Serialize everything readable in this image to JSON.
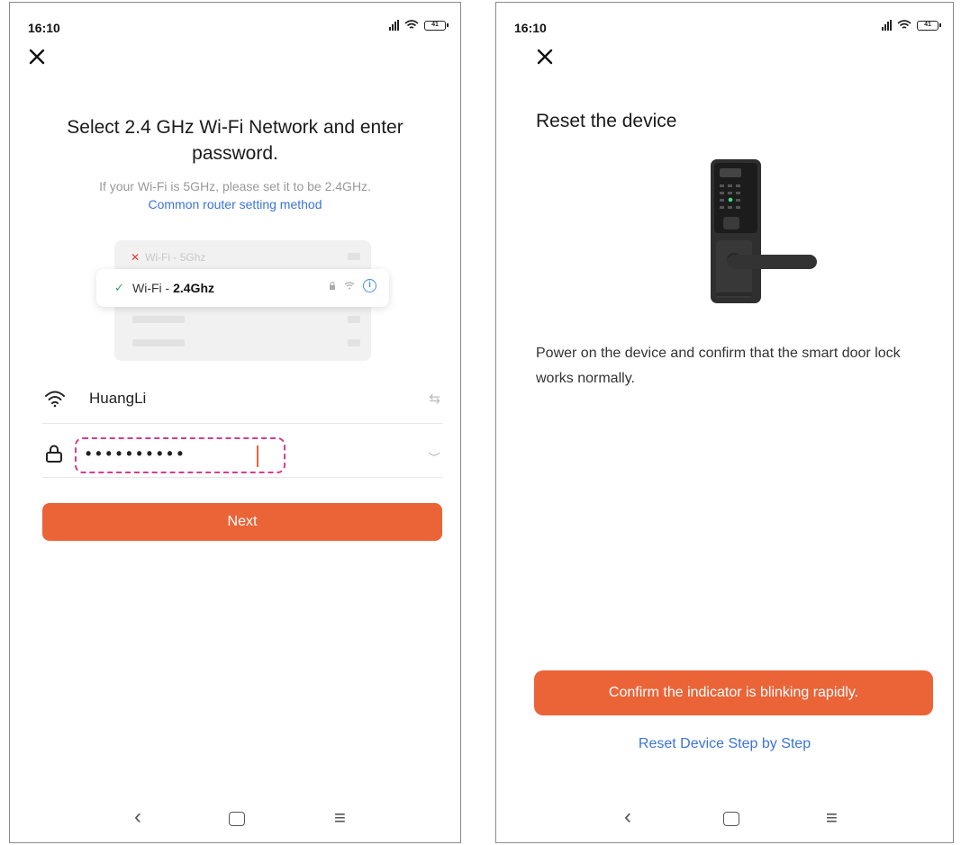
{
  "left": {
    "status_time": "16:10",
    "battery": "41",
    "title": "Select 2.4 GHz Wi-Fi Network and enter password.",
    "hint": "If your Wi-Fi is 5GHz, please set it to be 2.4GHz.",
    "router_link": "Common router setting method",
    "illus_5g_label": "Wi-Fi - 5Ghz",
    "illus_24_prefix": "Wi-Fi - ",
    "illus_24_bold": "2.4Ghz",
    "ssid": "HuangLi",
    "password_mask": "••••••••••",
    "next_label": "Next"
  },
  "right": {
    "status_time": "16:10",
    "battery": "41",
    "title": "Reset the device",
    "description": "Power on the device and confirm that the smart door lock works normally.",
    "confirm_label": "Confirm the indicator is blinking rapidly.",
    "reset_link": "Reset Device Step by Step"
  },
  "icons": {
    "close": "close-icon",
    "wifi": "wifi-icon",
    "lock": "lock-icon",
    "switch": "switch-network-icon",
    "eye": "eye-closed-icon",
    "back": "nav-back-icon",
    "home": "nav-home-icon",
    "menu": "nav-menu-icon"
  },
  "colors": {
    "accent": "#ea6438",
    "link": "#3b74d6",
    "highlight_dash": "#d43d8d",
    "check_green": "#2ea36b"
  }
}
